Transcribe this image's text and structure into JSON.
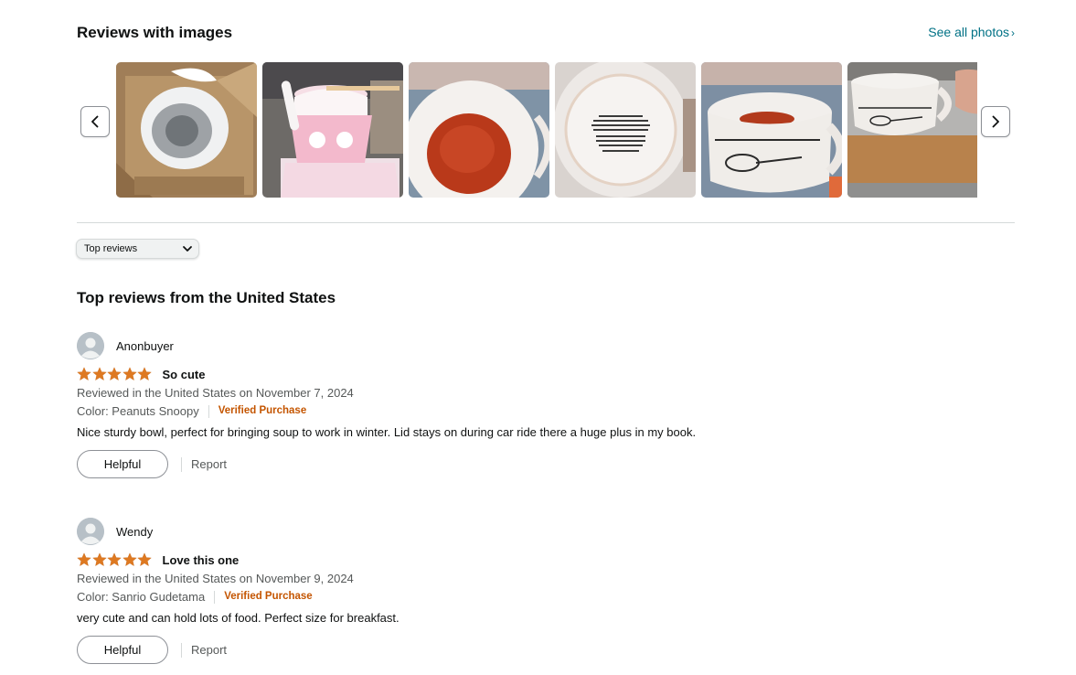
{
  "images_section": {
    "title": "Reviews with images",
    "see_all_label": "See all photos",
    "see_all_chevron": "›"
  },
  "sort": {
    "selected": "Top reviews"
  },
  "reviews_section": {
    "title": "Top reviews from the United States"
  },
  "reviews": [
    {
      "profile_name": "Anonbuyer",
      "rating": 5,
      "title": "So cute",
      "date": "Reviewed in the United States on November 7, 2024",
      "variant": "Color: Peanuts Snoopy",
      "verified": "Verified Purchase",
      "body": "Nice sturdy bowl, perfect for bringing soup to work in winter. Lid stays on during car ride there a huge plus in my book.",
      "helpful_label": "Helpful",
      "report_label": "Report"
    },
    {
      "profile_name": "Wendy",
      "rating": 5,
      "title": "Love this one",
      "date": "Reviewed in the United States on November 9, 2024",
      "variant": "Color: Sanrio Gudetama",
      "verified": "Verified Purchase",
      "body": "very cute and can hold lots of food. Perfect size for breakfast.",
      "helpful_label": "Helpful",
      "report_label": "Report"
    }
  ],
  "colors": {
    "link": "#007185",
    "star": "#de7921",
    "verified": "#c45500",
    "muted_text": "#565959"
  }
}
